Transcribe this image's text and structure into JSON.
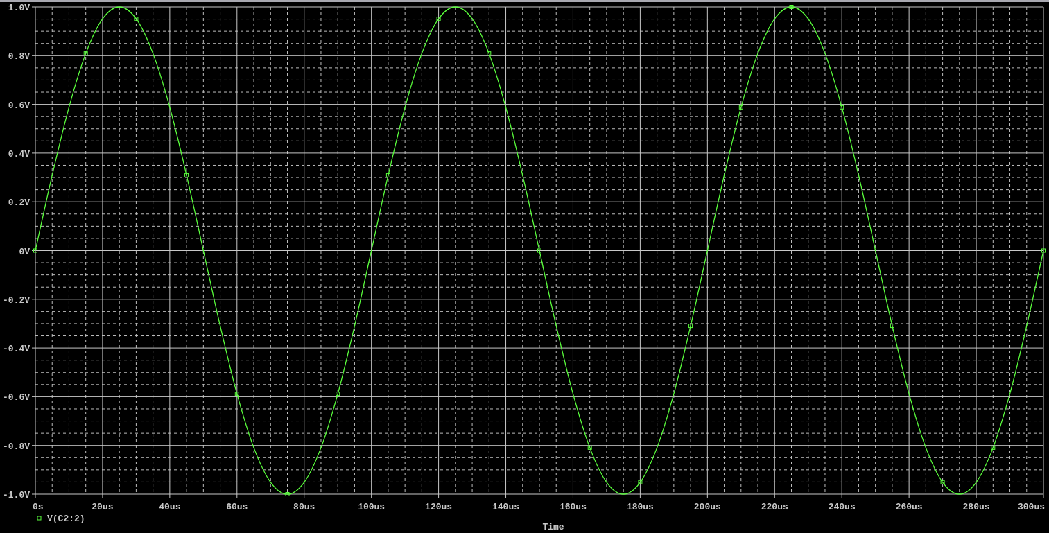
{
  "plot": {
    "chart_data": {
      "type": "line",
      "xlabel": "Time",
      "x": [
        0,
        5,
        10,
        15,
        20,
        25,
        30,
        35,
        40,
        45,
        50,
        55,
        60,
        65,
        70,
        75,
        80,
        85,
        90,
        95,
        100,
        105,
        110,
        115,
        120,
        125,
        130,
        135,
        140,
        145,
        150,
        155,
        160,
        165,
        170,
        175,
        180,
        185,
        190,
        195,
        200,
        205,
        210,
        215,
        220,
        225,
        230,
        235,
        240,
        245,
        250,
        255,
        260,
        265,
        270,
        275,
        280,
        285,
        290,
        295,
        300
      ],
      "series": [
        {
          "name": "V(C2:2)",
          "color": "#5aff3c",
          "values": [
            0,
            0.309,
            0.588,
            0.809,
            0.951,
            1,
            0.951,
            0.809,
            0.588,
            0.309,
            0,
            -0.309,
            -0.588,
            -0.809,
            -0.951,
            -1,
            -0.951,
            -0.809,
            -0.588,
            -0.309,
            0,
            0.309,
            0.588,
            0.809,
            0.951,
            1,
            0.951,
            0.809,
            0.588,
            0.309,
            0,
            -0.309,
            -0.588,
            -0.809,
            -0.951,
            -1,
            -0.951,
            -0.809,
            -0.588,
            -0.309,
            0,
            0.309,
            0.588,
            0.809,
            0.951,
            1,
            0.951,
            0.809,
            0.588,
            0.309,
            0,
            -0.309,
            -0.588,
            -0.809,
            -0.951,
            -1,
            -0.951,
            -0.809,
            -0.588,
            -0.309,
            0
          ]
        }
      ],
      "grid": true,
      "xlim": [
        0,
        300
      ],
      "ylim": [
        -1,
        1
      ],
      "xticks": [
        {
          "value": 0,
          "label": "0s"
        },
        {
          "value": 20,
          "label": "20us"
        },
        {
          "value": 40,
          "label": "40us"
        },
        {
          "value": 60,
          "label": "60us"
        },
        {
          "value": 80,
          "label": "80us"
        },
        {
          "value": 100,
          "label": "100us"
        },
        {
          "value": 120,
          "label": "120us"
        },
        {
          "value": 140,
          "label": "140us"
        },
        {
          "value": 160,
          "label": "160us"
        },
        {
          "value": 180,
          "label": "180us"
        },
        {
          "value": 200,
          "label": "200us"
        },
        {
          "value": 220,
          "label": "220us"
        },
        {
          "value": 240,
          "label": "240us"
        },
        {
          "value": 260,
          "label": "260us"
        },
        {
          "value": 280,
          "label": "280us"
        },
        {
          "value": 300,
          "label": "300us"
        }
      ],
      "yticks": [
        {
          "value": 1,
          "label": "1.0V"
        },
        {
          "value": 0.8,
          "label": "0.8V"
        },
        {
          "value": 0.6,
          "label": "0.6V"
        },
        {
          "value": 0.4,
          "label": "0.4V"
        },
        {
          "value": 0.2,
          "label": "0.2V"
        },
        {
          "value": 0,
          "label": "0V"
        },
        {
          "value": -0.2,
          "label": "-0.2V"
        },
        {
          "value": -0.4,
          "label": "-0.4V"
        },
        {
          "value": -0.6,
          "label": "-0.6V"
        },
        {
          "value": -0.8,
          "label": "-0.8V"
        },
        {
          "value": -1,
          "label": "-1.0V"
        }
      ]
    }
  }
}
